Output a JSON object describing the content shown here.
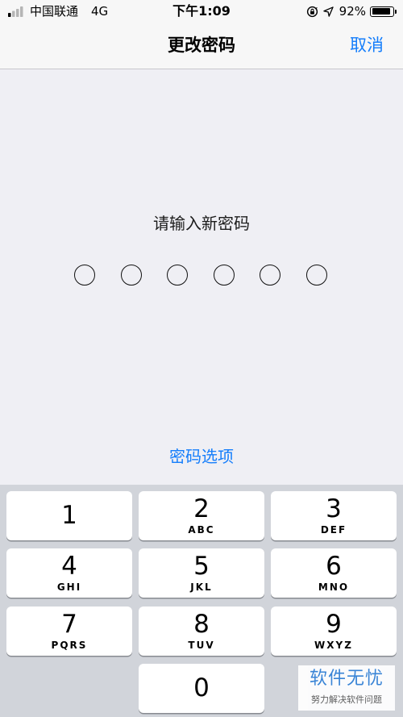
{
  "status_bar": {
    "carrier": "中国联通",
    "network": "4G",
    "time": "下午1:09",
    "battery_percent": "92%",
    "battery_level": 0.92,
    "signal_bars_filled": 1,
    "icons": [
      "signal-icon",
      "rotation-lock-icon",
      "location-arrow-icon",
      "battery-icon"
    ]
  },
  "nav": {
    "title": "更改密码",
    "cancel": "取消"
  },
  "passcode": {
    "prompt": "请输入新密码",
    "length": 6,
    "entered": 0,
    "options": "密码选项"
  },
  "keypad": {
    "keys": [
      {
        "digit": "1",
        "letters": ""
      },
      {
        "digit": "2",
        "letters": "ABC"
      },
      {
        "digit": "3",
        "letters": "DEF"
      },
      {
        "digit": "4",
        "letters": "GHI"
      },
      {
        "digit": "5",
        "letters": "JKL"
      },
      {
        "digit": "6",
        "letters": "MNO"
      },
      {
        "digit": "7",
        "letters": "PQRS"
      },
      {
        "digit": "8",
        "letters": "TUV"
      },
      {
        "digit": "9",
        "letters": "WXYZ"
      },
      {
        "digit": "0",
        "letters": ""
      }
    ]
  },
  "watermark": {
    "title": "软件无忧",
    "subtitle": "努力解决软件问题"
  },
  "colors": {
    "accent": "#157efb",
    "background": "#efeff4",
    "keypad_background": "#d1d4da",
    "key_background": "#ffffff"
  }
}
